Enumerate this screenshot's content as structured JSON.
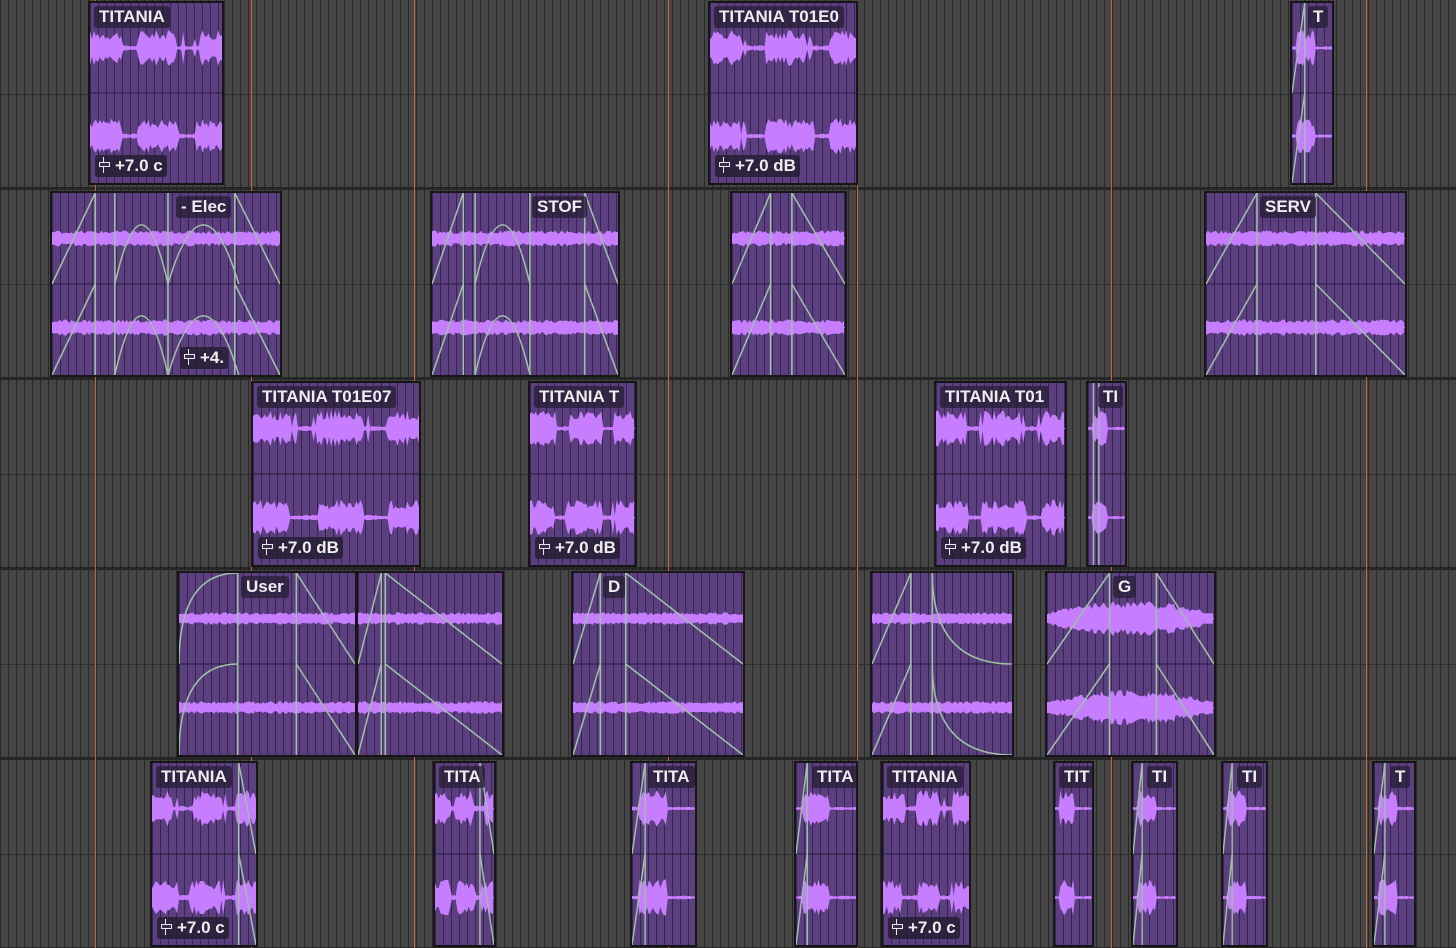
{
  "app": {
    "view": "arrange-timeline"
  },
  "colors": {
    "background": "#454545",
    "clip": "#5b3f7f",
    "waveform": "#c77dff",
    "fade": "#9fbfa6",
    "marker": "#d2603a",
    "label_bg": "#261e34"
  },
  "icons": {
    "gain": "fader-icon"
  },
  "tracks": [
    {
      "name": "",
      "clips": [
        {
          "label": "TITANIA",
          "gain": "+7.0 c"
        },
        {
          "label": "TITANIA T01E0",
          "gain": "+7.0 dB"
        },
        {
          "label": "T",
          "gain": ""
        }
      ]
    },
    {
      "name": "",
      "clips": [
        {
          "label": "- Elec",
          "gain": "+4."
        },
        {
          "label": "STOF",
          "gain": ""
        },
        {
          "label": "",
          "gain": ""
        },
        {
          "label": "SERV",
          "gain": ""
        }
      ]
    },
    {
      "name": "",
      "clips": [
        {
          "label": "TITANIA T01E07",
          "gain": "+7.0 dB"
        },
        {
          "label": "TITANIA T",
          "gain": "+7.0 dB"
        },
        {
          "label": "TITANIA T01",
          "gain": "+7.0 dB"
        },
        {
          "label": "TI",
          "gain": ""
        }
      ]
    },
    {
      "name": "",
      "clips": [
        {
          "label": "User",
          "gain": ""
        },
        {
          "label": "",
          "gain": ""
        },
        {
          "label": "D",
          "gain": ""
        },
        {
          "label": "",
          "gain": ""
        },
        {
          "label": "G",
          "gain": ""
        }
      ]
    },
    {
      "name": "",
      "clips": [
        {
          "label": "TITANIA",
          "gain": "+7.0 c"
        },
        {
          "label": "TITA",
          "gain": ""
        },
        {
          "label": "TITA",
          "gain": ""
        },
        {
          "label": "TITA",
          "gain": ""
        },
        {
          "label": "TITANIA",
          "gain": "+7.0 c"
        },
        {
          "label": "TIT",
          "gain": ""
        },
        {
          "label": "TI",
          "gain": ""
        },
        {
          "label": "TI",
          "gain": ""
        },
        {
          "label": "T",
          "gain": ""
        }
      ]
    }
  ]
}
